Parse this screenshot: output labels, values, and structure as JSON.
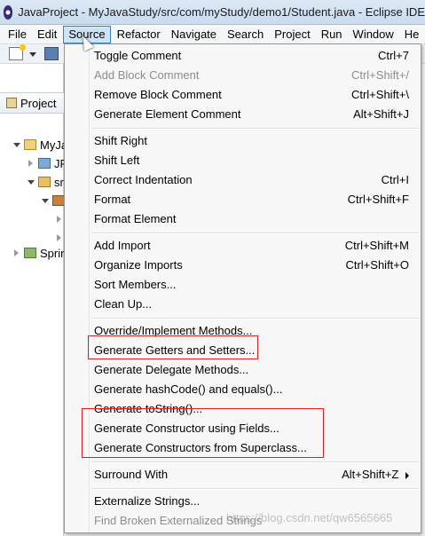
{
  "window": {
    "title": "JavaProject - MyJavaStudy/src/com/myStudy/demo1/Student.java - Eclipse IDE"
  },
  "menubar": {
    "items": [
      "File",
      "Edit",
      "Source",
      "Refactor",
      "Navigate",
      "Search",
      "Project",
      "Run",
      "Window",
      "He"
    ],
    "active": "Source"
  },
  "explorer": {
    "tab_label": "Project",
    "rows": [
      "MyJa",
      "JR",
      "sr",
      "",
      "",
      "",
      "Sprin"
    ]
  },
  "source_menu": {
    "groups": [
      [
        {
          "label": "Toggle Comment",
          "shortcut": "Ctrl+7",
          "enabled": true
        },
        {
          "label": "Add Block Comment",
          "shortcut": "Ctrl+Shift+/",
          "enabled": false
        },
        {
          "label": "Remove Block Comment",
          "shortcut": "Ctrl+Shift+\\",
          "enabled": true
        },
        {
          "label": "Generate Element Comment",
          "shortcut": "Alt+Shift+J",
          "enabled": true
        }
      ],
      [
        {
          "label": "Shift Right",
          "shortcut": "",
          "enabled": true
        },
        {
          "label": "Shift Left",
          "shortcut": "",
          "enabled": true
        },
        {
          "label": "Correct Indentation",
          "shortcut": "Ctrl+I",
          "enabled": true
        },
        {
          "label": "Format",
          "shortcut": "Ctrl+Shift+F",
          "enabled": true
        },
        {
          "label": "Format Element",
          "shortcut": "",
          "enabled": true
        }
      ],
      [
        {
          "label": "Add Import",
          "shortcut": "Ctrl+Shift+M",
          "enabled": true
        },
        {
          "label": "Organize Imports",
          "shortcut": "Ctrl+Shift+O",
          "enabled": true
        },
        {
          "label": "Sort Members...",
          "shortcut": "",
          "enabled": true
        },
        {
          "label": "Clean Up...",
          "shortcut": "",
          "enabled": true
        }
      ],
      [
        {
          "label": "Override/Implement Methods...",
          "shortcut": "",
          "enabled": true
        },
        {
          "label": "Generate Getters and Setters...",
          "shortcut": "",
          "enabled": true
        },
        {
          "label": "Generate Delegate Methods...",
          "shortcut": "",
          "enabled": true
        },
        {
          "label": "Generate hashCode() and equals()...",
          "shortcut": "",
          "enabled": true
        },
        {
          "label": "Generate toString()...",
          "shortcut": "",
          "enabled": true
        },
        {
          "label": "Generate Constructor using Fields...",
          "shortcut": "",
          "enabled": true
        },
        {
          "label": "Generate Constructors from Superclass...",
          "shortcut": "",
          "enabled": true
        }
      ],
      [
        {
          "label": "Surround With",
          "shortcut": "Alt+Shift+Z",
          "enabled": true,
          "submenu": true
        }
      ],
      [
        {
          "label": "Externalize Strings...",
          "shortcut": "",
          "enabled": true
        },
        {
          "label": "Find Broken Externalized Strings",
          "shortcut": "",
          "enabled": false
        }
      ]
    ]
  },
  "watermark": "https://blog.csdn.net/qw6565665",
  "colors": {
    "highlight_border": "#e02020",
    "menu_background": "#f7f7f7",
    "active_menu_fill": "#cde3f7",
    "disabled_text": "#8d8d8d"
  }
}
